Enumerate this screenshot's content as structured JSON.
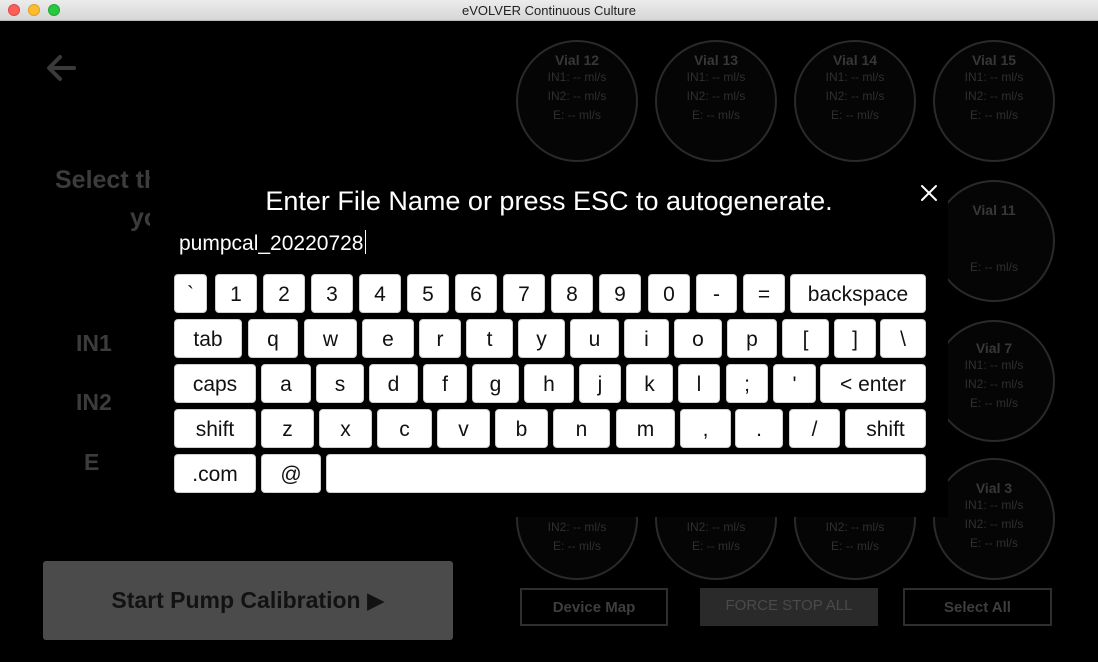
{
  "window": {
    "title": "eVOLVER Continuous Culture"
  },
  "background": {
    "select_line1": "Select th",
    "select_line2": "yo",
    "row_labels": [
      "IN1",
      "IN2",
      "E"
    ],
    "vials": [
      {
        "name": "Vial 12",
        "lines": [
          "IN1: -- ml/s",
          "IN2: -- ml/s",
          "E: -- ml/s"
        ]
      },
      {
        "name": "Vial 13",
        "lines": [
          "IN1: -- ml/s",
          "IN2: -- ml/s",
          "E: -- ml/s"
        ]
      },
      {
        "name": "Vial 14",
        "lines": [
          "IN1: -- ml/s",
          "IN2: -- ml/s",
          "E: -- ml/s"
        ]
      },
      {
        "name": "Vial 15",
        "lines": [
          "IN1: -- ml/s",
          "IN2: -- ml/s",
          "E: -- ml/s"
        ]
      },
      {
        "name": "Vial 11",
        "lines": [
          "E: -- ml/s"
        ]
      },
      {
        "name": "Vial 7",
        "lines": [
          "IN1: -- ml/s",
          "IN2: -- ml/s",
          "E: -- ml/s"
        ]
      },
      {
        "name": "Vial 3",
        "lines": [
          "IN1: -- ml/s",
          "IN2: -- ml/s",
          "E: -- ml/s"
        ]
      },
      {
        "name": "",
        "lines": [
          "IN2: -- ml/s",
          "E: -- ml/s"
        ]
      },
      {
        "name": "",
        "lines": [
          "IN2: -- ml/s",
          "E: -- ml/s"
        ]
      },
      {
        "name": "",
        "lines": [
          "IN2: -- ml/s",
          "E: -- ml/s"
        ]
      }
    ],
    "buttons": {
      "device_map": "Device Map",
      "force_stop": "FORCE STOP ALL",
      "select_all": "Select All",
      "start": "Start Pump Calibration ▶"
    }
  },
  "dialog": {
    "title": "Enter File Name or press ESC to autogenerate.",
    "filename_value": "pumpcal_20220728"
  },
  "keyboard": {
    "rows": [
      [
        "`",
        "1",
        "2",
        "3",
        "4",
        "5",
        "6",
        "7",
        "8",
        "9",
        "0",
        "-",
        "=",
        "backspace"
      ],
      [
        "tab",
        "q",
        "w",
        "e",
        "r",
        "t",
        "y",
        "u",
        "i",
        "o",
        "p",
        "[",
        "]",
        "\\"
      ],
      [
        "caps",
        "a",
        "s",
        "d",
        "f",
        "g",
        "h",
        "j",
        "k",
        "l",
        ";",
        "'",
        "< enter"
      ],
      [
        "shift",
        "z",
        "x",
        "c",
        "v",
        "b",
        "n",
        "m",
        ",",
        ".",
        "/",
        "shift"
      ],
      [
        ".com",
        "@",
        ""
      ]
    ]
  }
}
